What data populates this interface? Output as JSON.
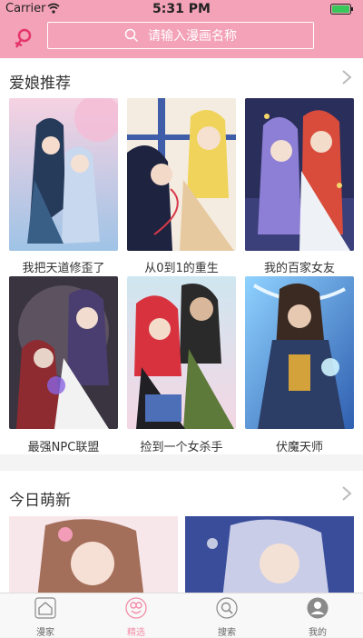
{
  "status": {
    "carrier": "Carrier",
    "time": "5:31 PM"
  },
  "search": {
    "placeholder": "请输入漫画名称"
  },
  "section1": {
    "title": "爱娘推荐",
    "items": [
      {
        "title": "我把天道修歪了"
      },
      {
        "title": "从0到1的重生"
      },
      {
        "title": "我的百家女友"
      },
      {
        "title": "最强NPC联盟"
      },
      {
        "title": "捡到一个女杀手"
      },
      {
        "title": "伏魔天师"
      }
    ]
  },
  "section2": {
    "title": "今日萌新"
  },
  "tabbar": {
    "tabs": [
      {
        "label": "漫家"
      },
      {
        "label": "精选"
      },
      {
        "label": "搜索"
      },
      {
        "label": "我的"
      }
    ],
    "active_index": 1
  },
  "colors": {
    "header": "#f3a2b7",
    "accent": "#f48ca8"
  }
}
